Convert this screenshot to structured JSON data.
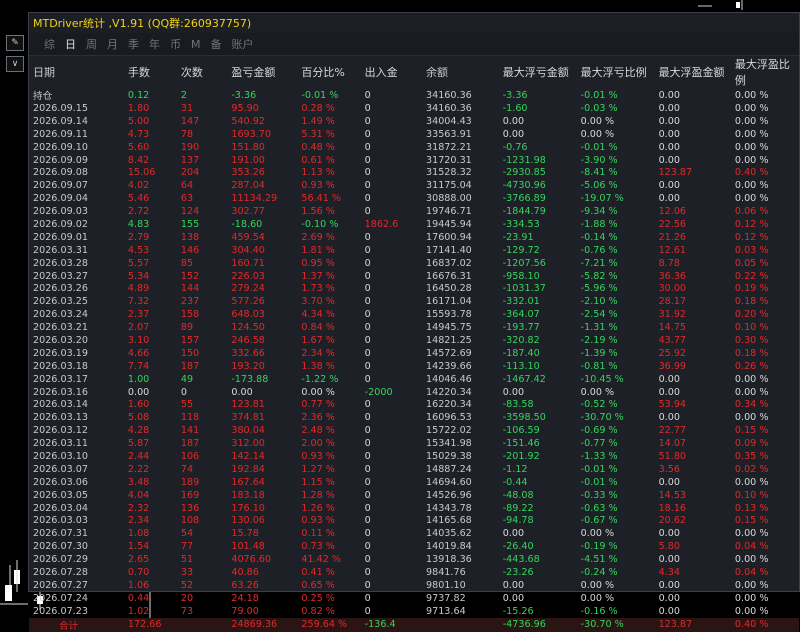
{
  "window": {
    "title": "MTDriver统计 ,V1.91 (QQ群:260937757)"
  },
  "tabs": [
    "综",
    "日",
    "周",
    "月",
    "季",
    "年",
    "币",
    "M",
    "备",
    "账户"
  ],
  "active_tab_index": 1,
  "headers": [
    "日期",
    "手数",
    "次数",
    "盈亏金额",
    "百分比%",
    "出入金",
    "余额",
    "最大浮亏金额",
    "最大浮亏比例",
    "最大浮盈金额",
    "最大浮盈比例"
  ],
  "rows": [
    [
      "持仓",
      "0.12",
      "2",
      "-3.36",
      "-0.01 %",
      "0",
      "34160.36",
      "-3.36",
      "-0.01 %",
      "0.00",
      "0.00 %"
    ],
    [
      "2026.09.15",
      "1.80",
      "31",
      "95.90",
      "0.28 %",
      "0",
      "34160.36",
      "-1.60",
      "-0.03 %",
      "0.00",
      "0.00 %"
    ],
    [
      "2026.09.14",
      "5.00",
      "147",
      "540.92",
      "1.49 %",
      "0",
      "34004.43",
      "0.00",
      "0.00 %",
      "0.00",
      "0.00 %"
    ],
    [
      "2026.09.11",
      "4.73",
      "78",
      "1693.70",
      "5.31 %",
      "0",
      "33563.91",
      "0.00",
      "0.00 %",
      "0.00",
      "0.00 %"
    ],
    [
      "2026.09.10",
      "5.60",
      "190",
      "151.80",
      "0.48 %",
      "0",
      "31872.21",
      "-0.76",
      "-0.01 %",
      "0.00",
      "0.00 %"
    ],
    [
      "2026.09.09",
      "8.42",
      "137",
      "191.00",
      "0.61 %",
      "0",
      "31720.31",
      "-1231.98",
      "-3.90 %",
      "0.00",
      "0.00 %"
    ],
    [
      "2026.09.08",
      "15.06",
      "204",
      "353.26",
      "1.13 %",
      "0",
      "31528.32",
      "-2930.85",
      "-8.41 %",
      "123.87",
      "0.40 %"
    ],
    [
      "2026.09.07",
      "4.02",
      "64",
      "287.04",
      "0.93 %",
      "0",
      "31175.04",
      "-4730.96",
      "-5.06 %",
      "0.00",
      "0.00 %"
    ],
    [
      "2026.09.04",
      "5.46",
      "63",
      "11134.29",
      "56.41 %",
      "0",
      "30888.00",
      "-3766.89",
      "-19.07 %",
      "0.00",
      "0.00 %"
    ],
    [
      "2026.09.03",
      "2.72",
      "124",
      "302.77",
      "1.56 %",
      "0",
      "19746.71",
      "-1844.79",
      "-9.34 %",
      "12.06",
      "0.06 %"
    ],
    [
      "2026.09.02",
      "4.83",
      "155",
      "-18.60",
      "-0.10 %",
      "1862.6",
      "19445.94",
      "-334.53",
      "-1.88 %",
      "22.56",
      "0.12 %"
    ],
    [
      "2026.09.01",
      "2.79",
      "138",
      "459.54",
      "2.69 %",
      "0",
      "17600.94",
      "-23.91",
      "-0.14 %",
      "21.26",
      "0.12 %"
    ],
    [
      "2026.03.31",
      "4.53",
      "146",
      "304.40",
      "1.81 %",
      "0",
      "17141.40",
      "-129.72",
      "-0.76 %",
      "12.61",
      "0.03 %"
    ],
    [
      "2026.03.28",
      "5.57",
      "85",
      "160.71",
      "0.95 %",
      "0",
      "16837.02",
      "-1207.56",
      "-7.21 %",
      "8.78",
      "0.05 %"
    ],
    [
      "2026.03.27",
      "5.34",
      "152",
      "226.03",
      "1.37 %",
      "0",
      "16676.31",
      "-958.10",
      "-5.82 %",
      "36.36",
      "0.22 %"
    ],
    [
      "2026.03.26",
      "4.89",
      "144",
      "279.24",
      "1.73 %",
      "0",
      "16450.28",
      "-1031.37",
      "-5.96 %",
      "30.00",
      "0.19 %"
    ],
    [
      "2026.03.25",
      "7.32",
      "237",
      "577.26",
      "3.70 %",
      "0",
      "16171.04",
      "-332.01",
      "-2.10 %",
      "28.17",
      "0.18 %"
    ],
    [
      "2026.03.24",
      "2.37",
      "158",
      "648.03",
      "4.34 %",
      "0",
      "15593.78",
      "-364.07",
      "-2.54 %",
      "31.92",
      "0.20 %"
    ],
    [
      "2026.03.21",
      "2.07",
      "89",
      "124.50",
      "0.84 %",
      "0",
      "14945.75",
      "-193.77",
      "-1.31 %",
      "14.75",
      "0.10 %"
    ],
    [
      "2026.03.20",
      "3.10",
      "157",
      "246.58",
      "1.67 %",
      "0",
      "14821.25",
      "-320.82",
      "-2.19 %",
      "43.77",
      "0.30 %"
    ],
    [
      "2026.03.19",
      "4.66",
      "150",
      "332.66",
      "2.34 %",
      "0",
      "14572.69",
      "-187.40",
      "-1.39 %",
      "25.92",
      "0.18 %"
    ],
    [
      "2026.03.18",
      "7.74",
      "187",
      "193.20",
      "1.38 %",
      "0",
      "14239.66",
      "-113.10",
      "-0.81 %",
      "36.99",
      "0.26 %"
    ],
    [
      "2026.03.17",
      "1.00",
      "49",
      "-173.88",
      "-1.22 %",
      "0",
      "14046.46",
      "-1467.42",
      "-10.45 %",
      "0.00",
      "0.00 %"
    ],
    [
      "2026.03.16",
      "0.00",
      "0",
      "0.00",
      "0.00 %",
      "-2000",
      "14220.34",
      "0.00",
      "0.00 %",
      "0.00",
      "0.00 %"
    ],
    [
      "2026.03.14",
      "1.60",
      "55",
      "123.81",
      "0.77 %",
      "0",
      "16220.34",
      "-83.58",
      "-0.52 %",
      "53.94",
      "0.34 %"
    ],
    [
      "2026.03.13",
      "5.08",
      "118",
      "374.81",
      "2.36 %",
      "0",
      "16096.53",
      "-3598.50",
      "-30.70 %",
      "0.00",
      "0.00 %"
    ],
    [
      "2026.03.12",
      "4.28",
      "141",
      "380.04",
      "2.48 %",
      "0",
      "15722.02",
      "-106.59",
      "-0.69 %",
      "22.77",
      "0.15 %"
    ],
    [
      "2026.03.11",
      "5.87",
      "187",
      "312.00",
      "2.00 %",
      "0",
      "15341.98",
      "-151.46",
      "-0.77 %",
      "14.07",
      "0.09 %"
    ],
    [
      "2026.03.10",
      "2.44",
      "106",
      "142.14",
      "0.93 %",
      "0",
      "15029.38",
      "-201.92",
      "-1.33 %",
      "51.80",
      "0.35 %"
    ],
    [
      "2026.03.07",
      "2.22",
      "74",
      "192.84",
      "1.27 %",
      "0",
      "14887.24",
      "-1.12",
      "-0.01 %",
      "3.56",
      "0.02 %"
    ],
    [
      "2026.03.06",
      "3.48",
      "189",
      "167.64",
      "1.15 %",
      "0",
      "14694.60",
      "-0.44",
      "-0.01 %",
      "0.00",
      "0.00 %"
    ],
    [
      "2026.03.05",
      "4.04",
      "169",
      "183.18",
      "1.28 %",
      "0",
      "14526.96",
      "-48.08",
      "-0.33 %",
      "14.53",
      "0.10 %"
    ],
    [
      "2026.03.04",
      "2.32",
      "136",
      "176.10",
      "1.26 %",
      "0",
      "14343.78",
      "-89.22",
      "-0.63 %",
      "18.16",
      "0.13 %"
    ],
    [
      "2026.03.03",
      "2.34",
      "108",
      "130.06",
      "0.93 %",
      "0",
      "14165.68",
      "-94.78",
      "-0.67 %",
      "20.62",
      "0.15 %"
    ],
    [
      "2026.07.31",
      "1.08",
      "54",
      "15.78",
      "0.11 %",
      "0",
      "14035.62",
      "0.00",
      "0.00 %",
      "0.00",
      "0.00 %"
    ],
    [
      "2026.07.30",
      "1.54",
      "77",
      "101.48",
      "0.73 %",
      "0",
      "14019.84",
      "-26.40",
      "-0.19 %",
      "5.80",
      "0.04 %"
    ],
    [
      "2026.07.29",
      "2.65",
      "51",
      "4076.60",
      "41.42 %",
      "0",
      "13918.36",
      "-443.68",
      "-4.51 %",
      "0.00",
      "0.00 %"
    ],
    [
      "2026.07.28",
      "0.70",
      "33",
      "40.86",
      "0.41 %",
      "0",
      "9841.76",
      "-23.26",
      "-0.24 %",
      "4.34",
      "0.04 %"
    ],
    [
      "2026.07.27",
      "1.06",
      "52",
      "63.26",
      "0.65 %",
      "0",
      "9801.10",
      "0.00",
      "0.00 %",
      "0.00",
      "0.00 %"
    ],
    [
      "2026.07.24",
      "0.44",
      "20",
      "24.18",
      "0.25 %",
      "0",
      "9737.82",
      "0.00",
      "0.00 %",
      "0.00",
      "0.00 %"
    ],
    [
      "2026.07.23",
      "1.02",
      "73",
      "79.00",
      "0.82 %",
      "0",
      "9713.64",
      "-15.26",
      "-0.16 %",
      "0.00",
      "0.00 %"
    ]
  ],
  "total": [
    "合计",
    "172.66",
    "",
    "24869.36",
    "259.64 %",
    "-136.4",
    "",
    "-4736.96",
    "-30.70 %",
    "123.87",
    "0.40 %"
  ],
  "colors": {
    "red": "#e02a2a",
    "green": "#35d45c",
    "title": "#f2d21a"
  }
}
